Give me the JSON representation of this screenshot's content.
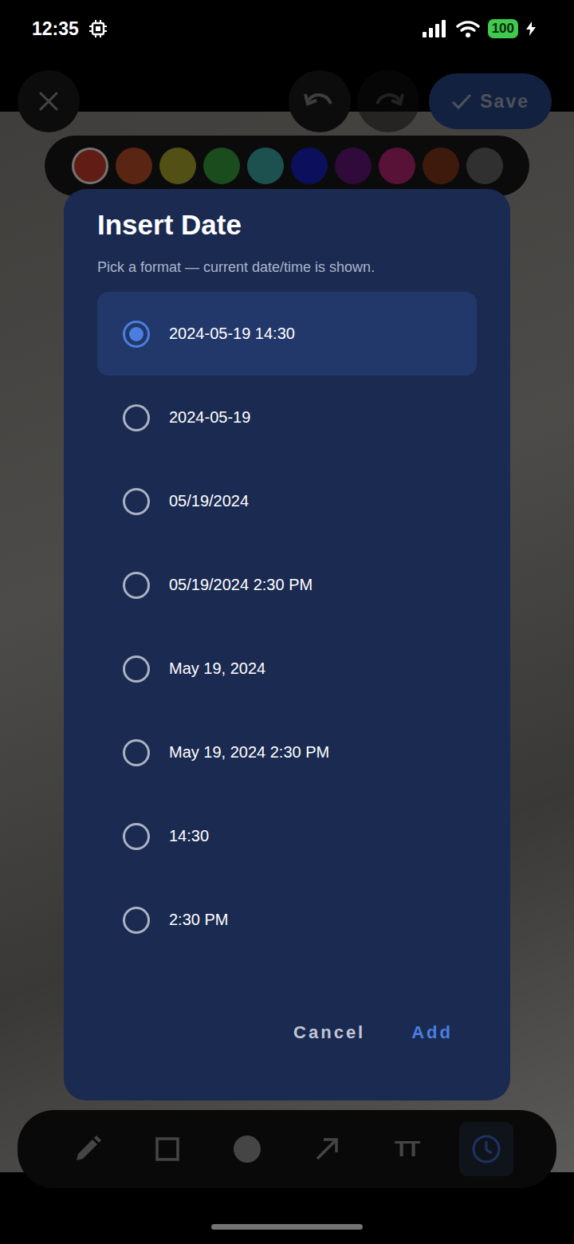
{
  "status_bar": {
    "time": "12:35",
    "battery": "100"
  },
  "toolbar": {
    "save": "Save",
    "undo": {
      "disabled": false
    },
    "redo": {
      "disabled": true
    }
  },
  "palette": [
    {
      "color": "#d8412f",
      "selected": true
    },
    {
      "color": "#c8522a",
      "selected": false
    },
    {
      "color": "#b9b22f",
      "selected": false
    },
    {
      "color": "#3aa844",
      "selected": false
    },
    {
      "color": "#3fb3b0",
      "selected": false
    },
    {
      "color": "#1c22c9",
      "selected": false
    },
    {
      "color": "#6a1880",
      "selected": false
    },
    {
      "color": "#c4287a",
      "selected": false
    },
    {
      "color": "#8a3a1e",
      "selected": false
    },
    {
      "color": "#6b6b6b",
      "selected": false
    }
  ],
  "dialog": {
    "title": "Insert Date",
    "subtitle": "Pick a format — current date/time is shown.",
    "options": [
      {
        "label": "2024-05-19 14:30",
        "selected": true
      },
      {
        "label": "2024-05-19",
        "selected": false
      },
      {
        "label": "05/19/2024",
        "selected": false
      },
      {
        "label": "05/19/2024 2:30 PM",
        "selected": false
      },
      {
        "label": "May 19, 2024",
        "selected": false
      },
      {
        "label": "May 19, 2024 2:30 PM",
        "selected": false
      },
      {
        "label": "14:30",
        "selected": false
      },
      {
        "label": "2:30 PM",
        "selected": false
      }
    ],
    "buttons": [
      {
        "label": "Cancel",
        "primary": false
      },
      {
        "label": "Add",
        "primary": true
      }
    ]
  },
  "tools": [
    {
      "kind": "pencil",
      "selected": false
    },
    {
      "kind": "rectangle",
      "selected": false
    },
    {
      "kind": "circle",
      "selected": false
    },
    {
      "kind": "arrow",
      "selected": false
    },
    {
      "kind": "text",
      "glyph": "TT",
      "selected": false
    },
    {
      "kind": "clock",
      "selected": true
    }
  ]
}
